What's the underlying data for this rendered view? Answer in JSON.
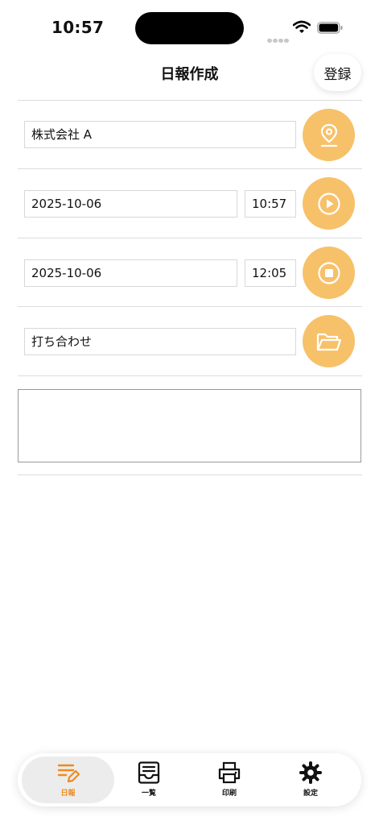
{
  "status_bar": {
    "time": "10:57"
  },
  "header": {
    "title": "日報作成",
    "register_label": "登録"
  },
  "form": {
    "company": "株式会社 A",
    "start_date": "2025-10-06",
    "start_time": "10:57",
    "end_date": "2025-10-06",
    "end_time": "12:05",
    "category": "打ち合わせ",
    "notes": ""
  },
  "tabs": [
    {
      "label": "日報",
      "icon": "edit-list-icon",
      "active": true
    },
    {
      "label": "一覧",
      "icon": "inbox-icon",
      "active": false
    },
    {
      "label": "印刷",
      "icon": "printer-icon",
      "active": false
    },
    {
      "label": "設定",
      "icon": "gear-icon",
      "active": false
    }
  ],
  "colors": {
    "accent": "#f7c16a",
    "active_tab": "#f08a1c"
  }
}
